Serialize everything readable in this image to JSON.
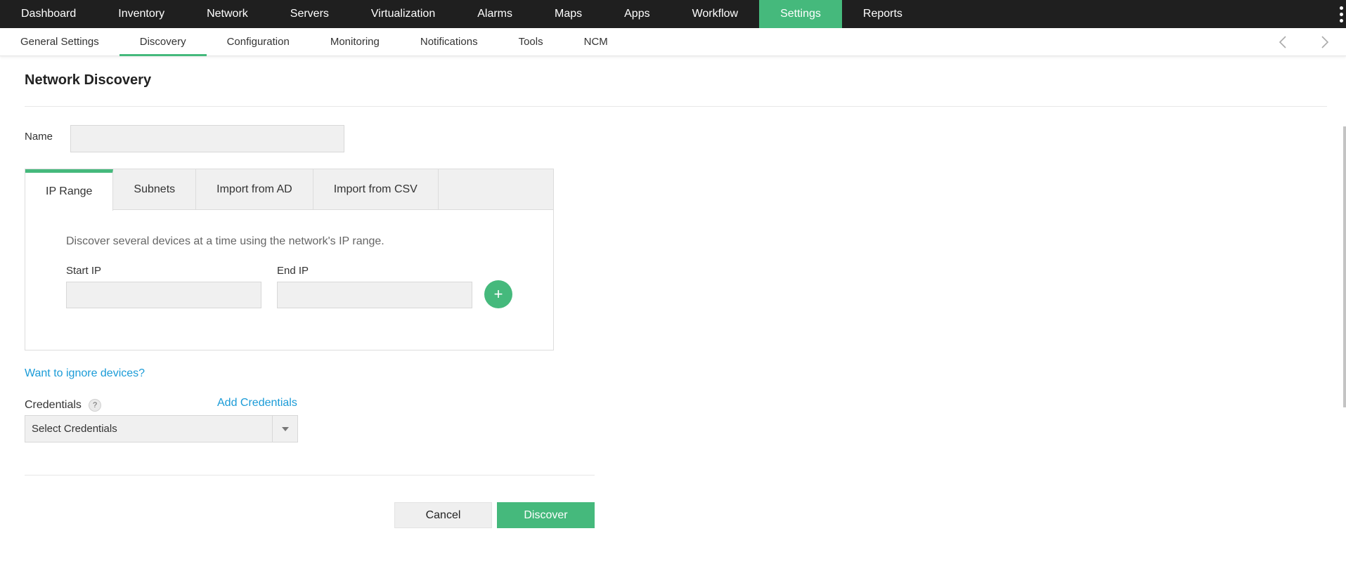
{
  "topnav": {
    "items": [
      {
        "label": "Dashboard"
      },
      {
        "label": "Inventory"
      },
      {
        "label": "Network"
      },
      {
        "label": "Servers"
      },
      {
        "label": "Virtualization"
      },
      {
        "label": "Alarms"
      },
      {
        "label": "Maps"
      },
      {
        "label": "Apps"
      },
      {
        "label": "Workflow"
      },
      {
        "label": "Settings"
      },
      {
        "label": "Reports"
      }
    ],
    "active": "Settings"
  },
  "subnav": {
    "items": [
      {
        "label": "General Settings"
      },
      {
        "label": "Discovery"
      },
      {
        "label": "Configuration"
      },
      {
        "label": "Monitoring"
      },
      {
        "label": "Notifications"
      },
      {
        "label": "Tools"
      },
      {
        "label": "NCM"
      }
    ],
    "active": "Discovery"
  },
  "page": {
    "title": "Network Discovery",
    "name_label": "Name",
    "name_value": ""
  },
  "tabs": {
    "items": [
      {
        "label": "IP Range"
      },
      {
        "label": "Subnets"
      },
      {
        "label": "Import from AD"
      },
      {
        "label": "Import from CSV"
      }
    ],
    "active": "IP Range"
  },
  "ip_range": {
    "description": "Discover several devices at a time using the network's IP range.",
    "start_label": "Start IP",
    "end_label": "End IP",
    "start_value": "",
    "end_value": "",
    "add_symbol": "+"
  },
  "ignore": {
    "link": "Want to ignore devices?"
  },
  "credentials": {
    "label": "Credentials",
    "help": "?",
    "add_link": "Add Credentials",
    "selected": "Select Credentials"
  },
  "actions": {
    "cancel": "Cancel",
    "discover": "Discover"
  },
  "colors": {
    "accent": "#45b97c",
    "link": "#1a9bd7",
    "topbar": "#1f1f1f"
  }
}
